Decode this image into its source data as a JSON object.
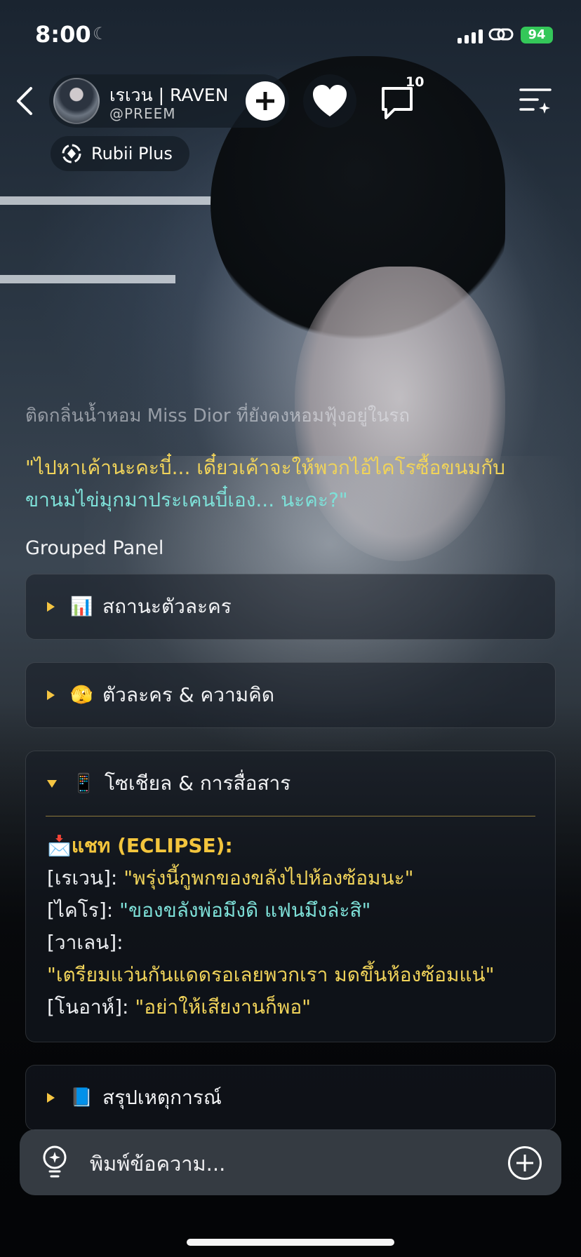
{
  "status_bar": {
    "time": "8:00",
    "battery": "94"
  },
  "header": {
    "profile_name": "เรเวน | RAVEN",
    "profile_handle": "@PREEM",
    "comment_count": "10",
    "badge_label": "Rubii Plus"
  },
  "story": {
    "faded_line": "ติดกลิ่นน้ำหอม Miss Dior ที่ยังคงหอมฟุ้งอยู่ในรถ",
    "quote_part1": "\"ไปหาเค้านะคะบี๋... เดี๋ยวเค้าจะให้พวกไอ้ไคโรซื้อขนมกับ",
    "quote_part2": "ขานมไข่มุกมาประเคนบี๋เอง... นะคะ?\""
  },
  "grouped_panel": {
    "title": "Grouped Panel",
    "sections": [
      {
        "emoji": "📊",
        "label": "สถานะตัวละคร",
        "expanded": false
      },
      {
        "emoji": "🫣",
        "label": "ตัวละคร & ความคิด",
        "expanded": false
      },
      {
        "emoji": "📱",
        "label": "โซเชียล & การสื่อสาร",
        "expanded": true
      },
      {
        "emoji": "📘",
        "label": "สรุปเหตุการณ์",
        "expanded": false
      }
    ],
    "chat": {
      "header": "📩แชท (ECLIPSE):",
      "lines": [
        {
          "speaker": "[เรเวน]: ",
          "text": "\"พรุ่งนี้กูพกของขลังไปห้องซ้อมนะ\""
        },
        {
          "speaker": "[ไคโร]: ",
          "text": "\"ของขลังพ่อมึงดิ แฟนมึงล่ะสิ\""
        },
        {
          "speaker": "[วาเลน]:",
          "text": ""
        },
        {
          "speaker": "",
          "text": "\"เตรียมแว่นกันแดดรอเลยพวกเรา มดขึ้นห้องซ้อมแน่\""
        },
        {
          "speaker": "[โนอาห์]: ",
          "text": "\"อย่าให้เสียงานก็พอ\""
        }
      ]
    }
  },
  "input": {
    "placeholder": "พิมพ์ข้อความ..."
  },
  "icons": {
    "back": "chevron-left-icon",
    "add": "plus-icon",
    "heart": "heart-icon",
    "comment": "speech-bubble-icon",
    "menu": "menu-sparkle-icon",
    "rubii": "rubii-swirl-icon",
    "bulb": "lightbulb-icon",
    "attach": "plus-circle-icon"
  },
  "colors": {
    "accent_yellow": "#f0d35a",
    "accent_teal": "#7ee0d8",
    "battery_green": "#34c759"
  }
}
